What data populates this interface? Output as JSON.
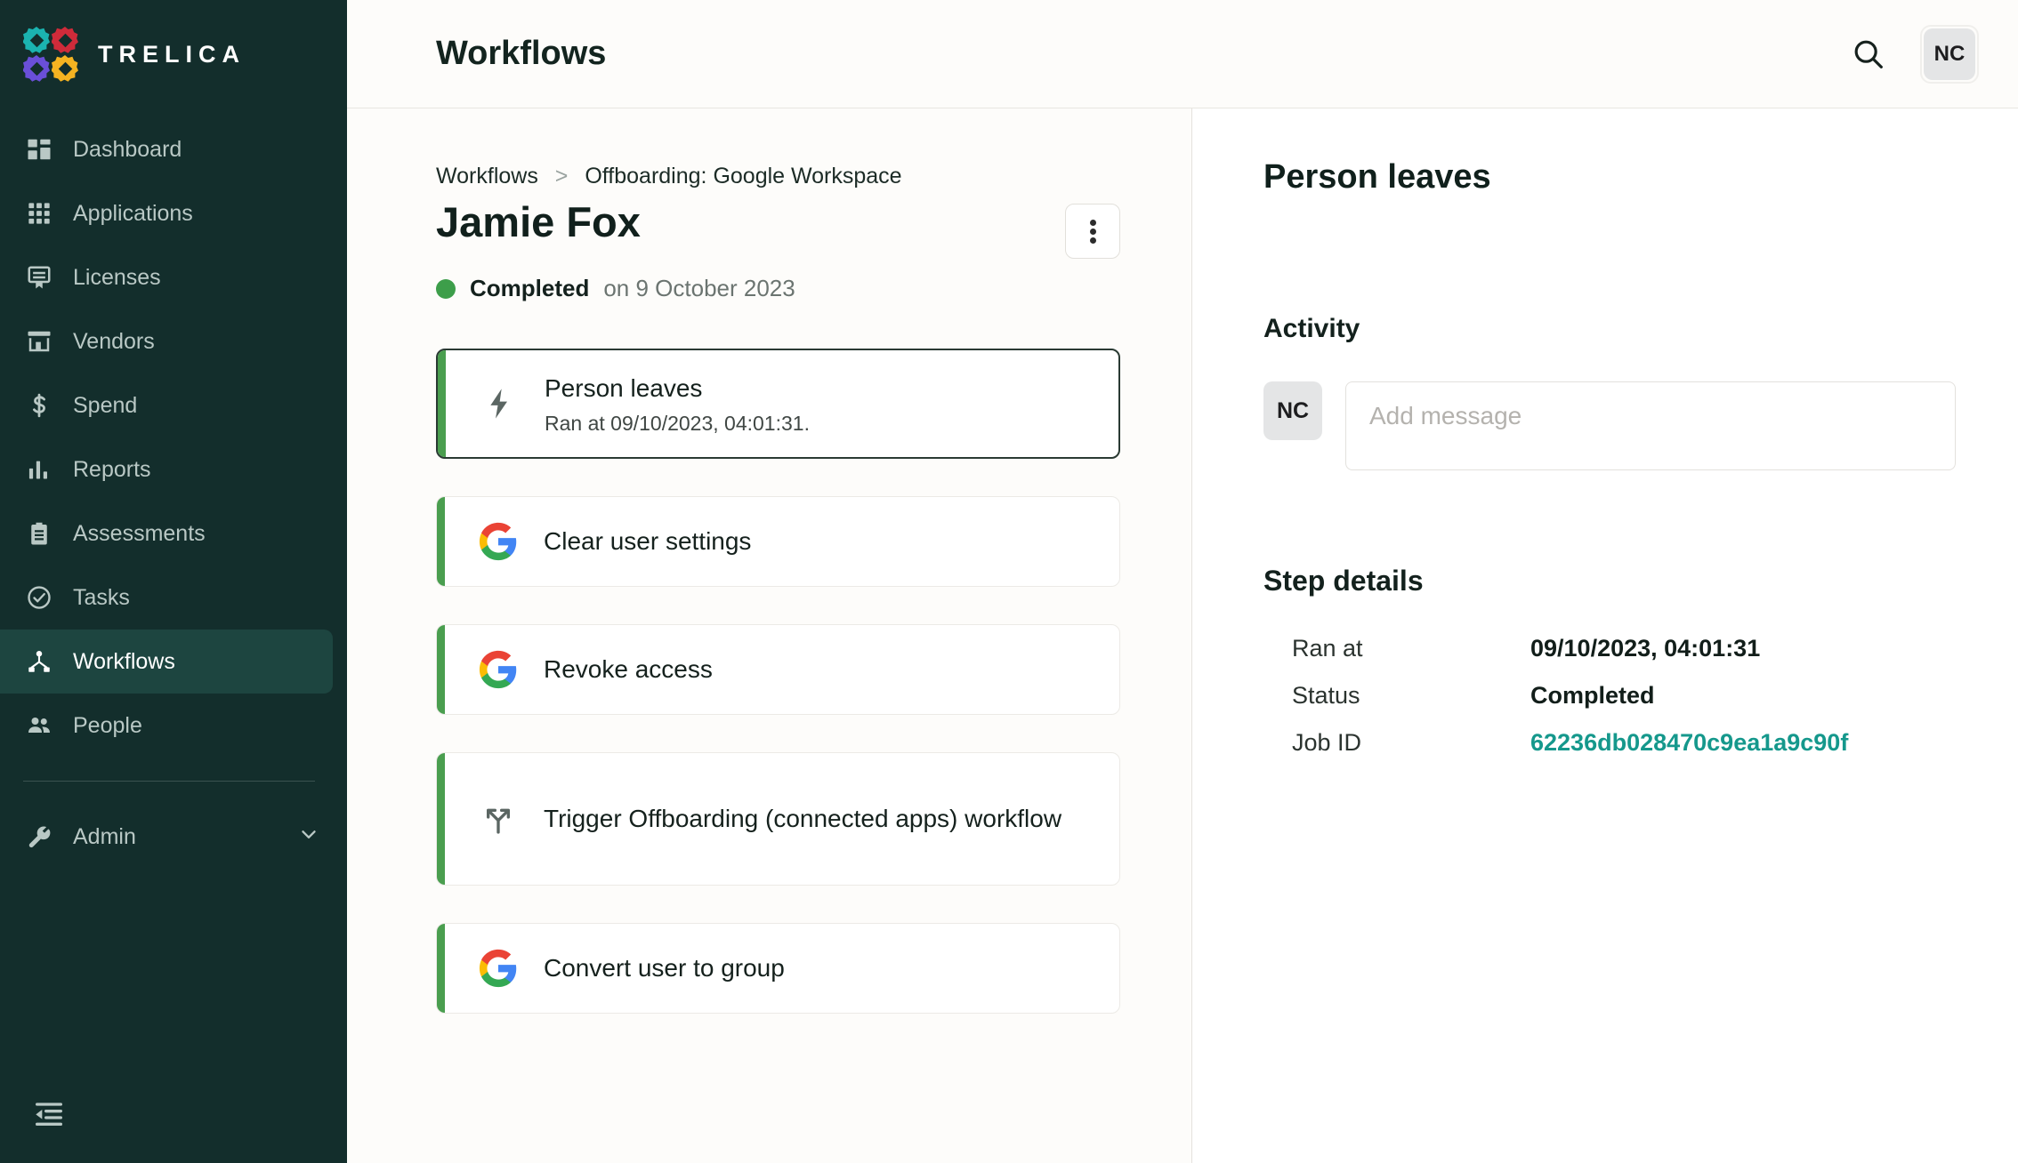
{
  "brand": {
    "name": "TRELICA",
    "logo_colors": [
      "#1bb3b0",
      "#cf2b3a",
      "#6a4fd8",
      "#f5b321"
    ]
  },
  "sidebar": {
    "items": [
      {
        "label": "Dashboard",
        "icon": "dashboard-icon",
        "active": false
      },
      {
        "label": "Applications",
        "icon": "apps-grid-icon",
        "active": false
      },
      {
        "label": "Licenses",
        "icon": "license-certificate-icon",
        "active": false
      },
      {
        "label": "Vendors",
        "icon": "storefront-icon",
        "active": false
      },
      {
        "label": "Spend",
        "icon": "dollar-icon",
        "active": false
      },
      {
        "label": "Reports",
        "icon": "bar-chart-icon",
        "active": false
      },
      {
        "label": "Assessments",
        "icon": "clipboard-icon",
        "active": false
      },
      {
        "label": "Tasks",
        "icon": "check-circle-icon",
        "active": false
      },
      {
        "label": "Workflows",
        "icon": "workflow-node-icon",
        "active": true
      },
      {
        "label": "People",
        "icon": "people-icon",
        "active": false
      }
    ],
    "admin": {
      "label": "Admin",
      "icon": "wrench-icon",
      "chevron": "chevron-down-icon"
    },
    "collapse": {
      "icon": "collapse-sidebar-icon"
    }
  },
  "topbar": {
    "title": "Workflows",
    "search_icon": "search-icon",
    "avatar_initials": "NC"
  },
  "center": {
    "breadcrumb": {
      "root": "Workflows",
      "separator": ">",
      "current": "Offboarding: Google Workspace"
    },
    "record_title": "Jamie Fox",
    "menu_icon": "kebab-menu-icon",
    "status": {
      "label": "Completed",
      "rest": "on 9 October 2023",
      "color": "#3d9e4a"
    },
    "steps": [
      {
        "name": "Person leaves",
        "sub": "Ran at 09/10/2023, 04:01:31.",
        "icon": "lightning-bolt-icon",
        "selected": true
      },
      {
        "name": "Clear user settings",
        "sub": "",
        "icon": "google-icon",
        "selected": false
      },
      {
        "name": "Revoke access",
        "sub": "",
        "icon": "google-icon",
        "selected": false
      },
      {
        "name": "Trigger Offboarding (connected apps) workflow",
        "sub": "",
        "icon": "branch-arrow-icon",
        "selected": false
      },
      {
        "name": "Convert user to group",
        "sub": "",
        "icon": "google-icon",
        "selected": false
      }
    ]
  },
  "right": {
    "title": "Person leaves",
    "activity_heading": "Activity",
    "activity_avatar": "NC",
    "message_placeholder": "Add message",
    "details_heading": "Step details",
    "details": [
      {
        "label": "Ran at",
        "value": "09/10/2023, 04:01:31",
        "link": false
      },
      {
        "label": "Status",
        "value": "Completed",
        "link": false
      },
      {
        "label": "Job ID",
        "value": "62236db028470c9ea1a9c90f",
        "link": true
      }
    ],
    "link_color": "#15988c"
  }
}
